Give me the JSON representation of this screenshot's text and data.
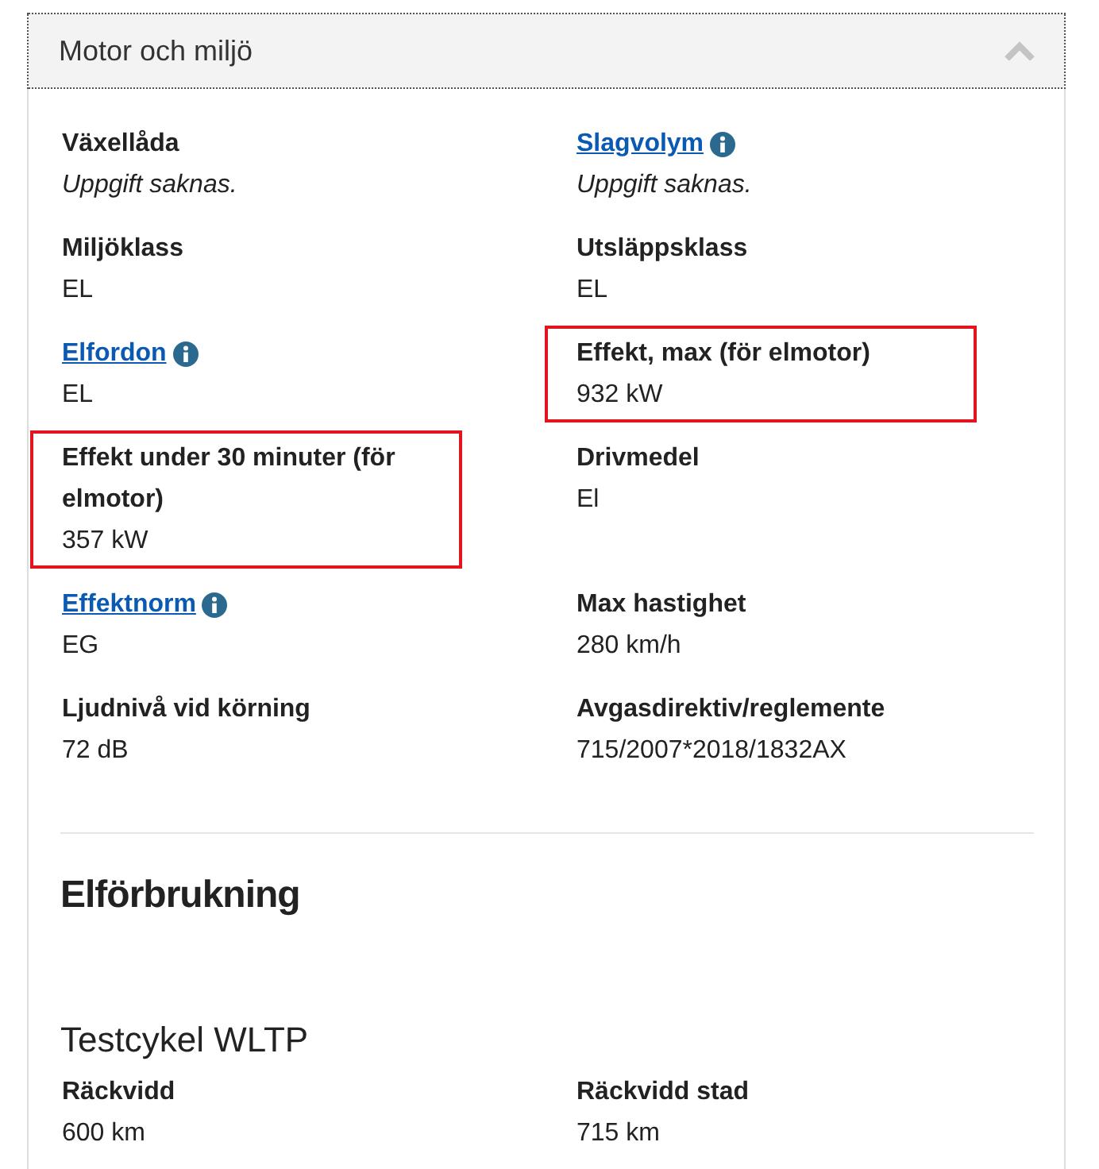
{
  "panel": {
    "title": "Motor och miljö",
    "expanded": true
  },
  "fields": [
    {
      "label": "Växellåda",
      "link": false,
      "info": false,
      "value": "Uppgift saknas.",
      "missing": true,
      "highlighted": false
    },
    {
      "label": "Slagvolym",
      "link": true,
      "info": true,
      "value": "Uppgift saknas.",
      "missing": true,
      "highlighted": false
    },
    {
      "label": "Miljöklass",
      "link": false,
      "info": false,
      "value": "EL",
      "missing": false,
      "highlighted": false
    },
    {
      "label": "Utsläppsklass",
      "link": false,
      "info": false,
      "value": "EL",
      "missing": false,
      "highlighted": false
    },
    {
      "label": "Elfordon",
      "link": true,
      "info": true,
      "value": "EL",
      "missing": false,
      "highlighted": false
    },
    {
      "label": "Effekt, max (för elmotor)",
      "link": false,
      "info": false,
      "value": "932 kW",
      "missing": false,
      "highlighted": true
    },
    {
      "label": "Effekt under 30 minuter (för elmotor)",
      "link": false,
      "info": false,
      "value": "357 kW",
      "missing": false,
      "highlighted": true
    },
    {
      "label": "Drivmedel",
      "link": false,
      "info": false,
      "value": "El",
      "missing": false,
      "highlighted": false
    },
    {
      "label": "Effektnorm",
      "link": true,
      "info": true,
      "value": "EG",
      "missing": false,
      "highlighted": false
    },
    {
      "label": "Max hastighet",
      "link": false,
      "info": false,
      "value": "280 km/h",
      "missing": false,
      "highlighted": false
    },
    {
      "label": "Ljudnivå vid körning",
      "link": false,
      "info": false,
      "value": "72 dB",
      "missing": false,
      "highlighted": false
    },
    {
      "label": "Avgasdirektiv/reglemente",
      "link": false,
      "info": false,
      "value": "715/2007*2018/1832AX",
      "missing": false,
      "highlighted": false
    }
  ],
  "section": {
    "title": "Elförbrukning",
    "subsections": [
      {
        "title": "Testcykel WLTP",
        "fields": [
          {
            "label": "Räckvidd",
            "link": false,
            "info": false,
            "value": "600 km",
            "missing": false,
            "highlighted": false
          },
          {
            "label": "Räckvidd stad",
            "link": false,
            "info": false,
            "value": "715 km",
            "missing": false,
            "highlighted": false
          }
        ]
      }
    ]
  }
}
